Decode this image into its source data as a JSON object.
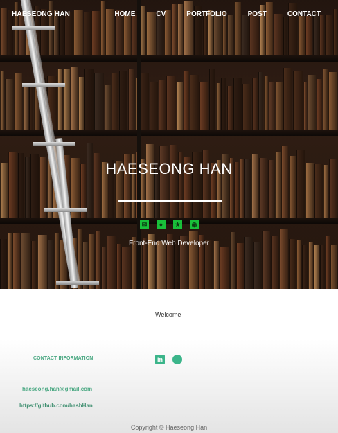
{
  "nav": {
    "brand": "HAESEONG HAN",
    "links": [
      "HOME",
      "CV",
      "PORTFOLIO",
      "POST",
      "CONTACT"
    ]
  },
  "hero": {
    "title": "HAESEONG HAN",
    "subtitle": "Front-End Web Developer",
    "social_icons": [
      "email-icon",
      "web-icon",
      "instagram-icon",
      "github-icon"
    ],
    "accent_color": "#19c03a"
  },
  "footer": {
    "welcome": "Welcome",
    "contact_heading": "CONTACT INFORMATION",
    "email": "haeseong.han@gmail.com",
    "github_url": "https://github.com/hashHan",
    "icons": [
      "linkedin-icon",
      "github-icon"
    ],
    "copyright": "Copyright © Haeseong Han",
    "accent_color": "#4aa882"
  }
}
